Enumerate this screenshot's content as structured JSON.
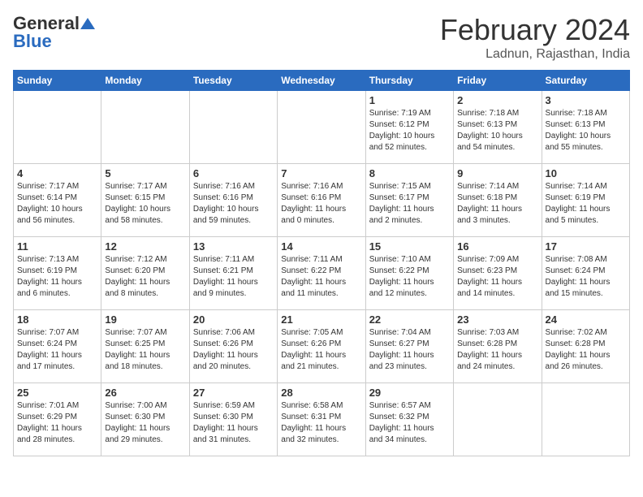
{
  "logo": {
    "general": "General",
    "blue": "Blue"
  },
  "title": {
    "month_year": "February 2024",
    "location": "Ladnun, Rajasthan, India"
  },
  "headers": [
    "Sunday",
    "Monday",
    "Tuesday",
    "Wednesday",
    "Thursday",
    "Friday",
    "Saturday"
  ],
  "weeks": [
    [
      {
        "day": "",
        "info": ""
      },
      {
        "day": "",
        "info": ""
      },
      {
        "day": "",
        "info": ""
      },
      {
        "day": "",
        "info": ""
      },
      {
        "day": "1",
        "info": "Sunrise: 7:19 AM\nSunset: 6:12 PM\nDaylight: 10 hours\nand 52 minutes."
      },
      {
        "day": "2",
        "info": "Sunrise: 7:18 AM\nSunset: 6:13 PM\nDaylight: 10 hours\nand 54 minutes."
      },
      {
        "day": "3",
        "info": "Sunrise: 7:18 AM\nSunset: 6:13 PM\nDaylight: 10 hours\nand 55 minutes."
      }
    ],
    [
      {
        "day": "4",
        "info": "Sunrise: 7:17 AM\nSunset: 6:14 PM\nDaylight: 10 hours\nand 56 minutes."
      },
      {
        "day": "5",
        "info": "Sunrise: 7:17 AM\nSunset: 6:15 PM\nDaylight: 10 hours\nand 58 minutes."
      },
      {
        "day": "6",
        "info": "Sunrise: 7:16 AM\nSunset: 6:16 PM\nDaylight: 10 hours\nand 59 minutes."
      },
      {
        "day": "7",
        "info": "Sunrise: 7:16 AM\nSunset: 6:16 PM\nDaylight: 11 hours\nand 0 minutes."
      },
      {
        "day": "8",
        "info": "Sunrise: 7:15 AM\nSunset: 6:17 PM\nDaylight: 11 hours\nand 2 minutes."
      },
      {
        "day": "9",
        "info": "Sunrise: 7:14 AM\nSunset: 6:18 PM\nDaylight: 11 hours\nand 3 minutes."
      },
      {
        "day": "10",
        "info": "Sunrise: 7:14 AM\nSunset: 6:19 PM\nDaylight: 11 hours\nand 5 minutes."
      }
    ],
    [
      {
        "day": "11",
        "info": "Sunrise: 7:13 AM\nSunset: 6:19 PM\nDaylight: 11 hours\nand 6 minutes."
      },
      {
        "day": "12",
        "info": "Sunrise: 7:12 AM\nSunset: 6:20 PM\nDaylight: 11 hours\nand 8 minutes."
      },
      {
        "day": "13",
        "info": "Sunrise: 7:11 AM\nSunset: 6:21 PM\nDaylight: 11 hours\nand 9 minutes."
      },
      {
        "day": "14",
        "info": "Sunrise: 7:11 AM\nSunset: 6:22 PM\nDaylight: 11 hours\nand 11 minutes."
      },
      {
        "day": "15",
        "info": "Sunrise: 7:10 AM\nSunset: 6:22 PM\nDaylight: 11 hours\nand 12 minutes."
      },
      {
        "day": "16",
        "info": "Sunrise: 7:09 AM\nSunset: 6:23 PM\nDaylight: 11 hours\nand 14 minutes."
      },
      {
        "day": "17",
        "info": "Sunrise: 7:08 AM\nSunset: 6:24 PM\nDaylight: 11 hours\nand 15 minutes."
      }
    ],
    [
      {
        "day": "18",
        "info": "Sunrise: 7:07 AM\nSunset: 6:24 PM\nDaylight: 11 hours\nand 17 minutes."
      },
      {
        "day": "19",
        "info": "Sunrise: 7:07 AM\nSunset: 6:25 PM\nDaylight: 11 hours\nand 18 minutes."
      },
      {
        "day": "20",
        "info": "Sunrise: 7:06 AM\nSunset: 6:26 PM\nDaylight: 11 hours\nand 20 minutes."
      },
      {
        "day": "21",
        "info": "Sunrise: 7:05 AM\nSunset: 6:26 PM\nDaylight: 11 hours\nand 21 minutes."
      },
      {
        "day": "22",
        "info": "Sunrise: 7:04 AM\nSunset: 6:27 PM\nDaylight: 11 hours\nand 23 minutes."
      },
      {
        "day": "23",
        "info": "Sunrise: 7:03 AM\nSunset: 6:28 PM\nDaylight: 11 hours\nand 24 minutes."
      },
      {
        "day": "24",
        "info": "Sunrise: 7:02 AM\nSunset: 6:28 PM\nDaylight: 11 hours\nand 26 minutes."
      }
    ],
    [
      {
        "day": "25",
        "info": "Sunrise: 7:01 AM\nSunset: 6:29 PM\nDaylight: 11 hours\nand 28 minutes."
      },
      {
        "day": "26",
        "info": "Sunrise: 7:00 AM\nSunset: 6:30 PM\nDaylight: 11 hours\nand 29 minutes."
      },
      {
        "day": "27",
        "info": "Sunrise: 6:59 AM\nSunset: 6:30 PM\nDaylight: 11 hours\nand 31 minutes."
      },
      {
        "day": "28",
        "info": "Sunrise: 6:58 AM\nSunset: 6:31 PM\nDaylight: 11 hours\nand 32 minutes."
      },
      {
        "day": "29",
        "info": "Sunrise: 6:57 AM\nSunset: 6:32 PM\nDaylight: 11 hours\nand 34 minutes."
      },
      {
        "day": "",
        "info": ""
      },
      {
        "day": "",
        "info": ""
      }
    ]
  ]
}
